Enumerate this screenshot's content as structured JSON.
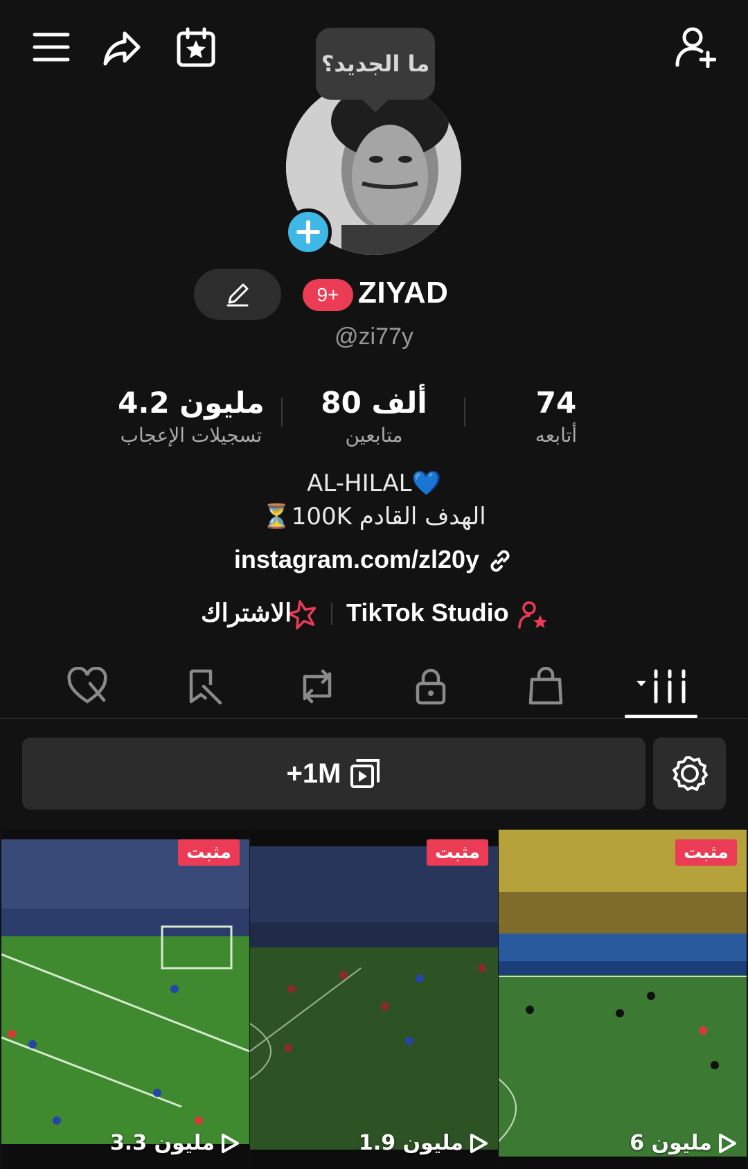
{
  "header": {
    "menu_icon": "hamburger-menu-icon",
    "share_icon": "share-arrow-icon",
    "calendar_icon": "calendar-star-icon",
    "add_friend_icon": "add-user-icon",
    "tooltip": "ما الجديد؟"
  },
  "profile": {
    "badge": "9+",
    "name": "ZIYAD",
    "handle": "@zi77y",
    "stats": [
      {
        "value": "4.2 مليون",
        "label": "تسجيلات الإعجاب"
      },
      {
        "value": "80 ألف",
        "label": "متابعين"
      },
      {
        "value": "74",
        "label": "أتابعه"
      }
    ],
    "bio_line1": "AL-HILAL💙",
    "bio_line2": "⏳100K الهدف القادم",
    "link": "instagram.com/zl20y",
    "studio_label": "TikTok Studio",
    "subscribe_label": "الاشتراك"
  },
  "tabs": [
    {
      "icon": "liked-hidden-icon"
    },
    {
      "icon": "favorites-hidden-icon"
    },
    {
      "icon": "repost-icon"
    },
    {
      "icon": "lock-icon"
    },
    {
      "icon": "shopping-bag-icon"
    },
    {
      "icon": "videos-grid-icon",
      "active": true
    }
  ],
  "collections": {
    "label": "+1M",
    "icon": "collection-play-icon",
    "settings_icon": "gear-icon"
  },
  "videos": [
    {
      "pinned": "مثبت",
      "views": "3.3 مليون"
    },
    {
      "pinned": "مثبت",
      "views": "1.9 مليون"
    },
    {
      "pinned": "مثبت",
      "views": "6 مليون"
    }
  ],
  "colors": {
    "background": "#121212",
    "accent_red": "#ec3b55",
    "accent_blue": "#3fb8e6"
  }
}
